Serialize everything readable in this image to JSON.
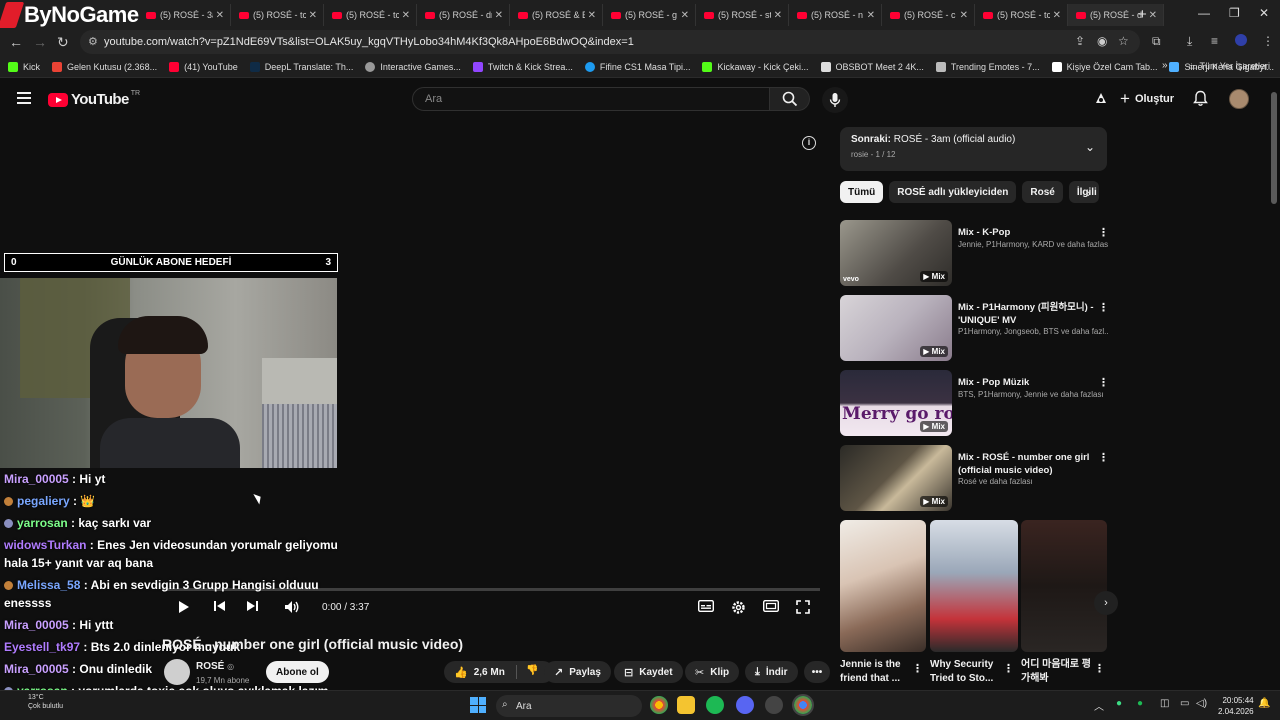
{
  "overlay": {
    "brand": "ByNoGame"
  },
  "browser": {
    "tabs": [
      {
        "title": "(5) ROSÉ - 3a"
      },
      {
        "title": "(5) ROSÉ - tc"
      },
      {
        "title": "(5) ROSÉ - tc"
      },
      {
        "title": "(5) ROSÉ - dr"
      },
      {
        "title": "(5) ROSÉ & B"
      },
      {
        "title": "(5) ROSÉ - g"
      },
      {
        "title": "(5) ROSÉ - st"
      },
      {
        "title": "(5) ROSÉ - n"
      },
      {
        "title": "(5) ROSÉ - c"
      },
      {
        "title": "(5) ROSÉ - tc"
      },
      {
        "title": "(5) ROSÉ - d"
      }
    ],
    "url": "youtube.com/watch?v=pZ1NdE69VTs&list=OLAK5uy_kgqVTHyLobo34hM4Kf3Qk8AHpoE6BdwOQ&index=1",
    "bookmarks": [
      {
        "label": "Kick",
        "color": "#53fc18"
      },
      {
        "label": "Gelen Kutusu (2.368...",
        "color": "#ea4335"
      },
      {
        "label": "(41) YouTube",
        "color": "#ff0033"
      },
      {
        "label": "DeepL Translate: Th...",
        "color": "#0f2b46"
      },
      {
        "label": "Interactive Games...",
        "color": "#999999"
      },
      {
        "label": "Twitch & Kick Strea...",
        "color": "#9146ff"
      },
      {
        "label": "Fifine CS1 Masa Tipi...",
        "color": "#1d9bf0"
      },
      {
        "label": "Kickaway - Kick Çeki...",
        "color": "#53fc18"
      },
      {
        "label": "OBSBOT Meet 2 4K...",
        "color": "#dddddd"
      },
      {
        "label": "Trending Emotes - 7...",
        "color": "#bbbbbb"
      },
      {
        "label": "Kişiye Özel Cam Tab...",
        "color": "#ffffff"
      },
      {
        "label": "Sinerji Keria Gigabyt...",
        "color": "#4fb0ff"
      }
    ],
    "all_bookmarks": "Tüm Yer İşaretleri"
  },
  "yt_header": {
    "logo_text": "YouTube",
    "country": "TR",
    "search_placeholder": "Ara",
    "create_label": "Oluştur"
  },
  "stream_overlay": {
    "goal_left": "0",
    "goal_title": "GÜNLÜK ABONE HEDEFİ",
    "goal_right": "3",
    "chat": [
      {
        "user": "Mira_00005",
        "text": " : Hi yt",
        "color": "#c9a0ff",
        "badge": ""
      },
      {
        "user": "pegaliery",
        "text": " : 👑",
        "color": "#7aa7ff",
        "badge": "#c2803a"
      },
      {
        "user": "yarrosan",
        "text": " : kaç sarkı var",
        "color": "#7dff8a",
        "badge": "#8a8fbf"
      },
      {
        "user": "widowsTurkan",
        "text": " : Enes Jen videosundan yorumalr geliyomu hala 15+ yanıt var aq bana",
        "color": "#b07cff",
        "badge": ""
      },
      {
        "user": "Melissa_58",
        "text": " : Abi en sevdigin 3 Grupp Hangisi olduuu enessss",
        "color": "#7aa7ff",
        "badge": "#c2803a"
      },
      {
        "user": "Mira_00005",
        "text": " : Hi yttt",
        "color": "#c9a0ff",
        "badge": ""
      },
      {
        "user": "Eyestell_tk97",
        "text": " : Bts 2.0 dinleniyor muyduk",
        "color": "#b07cff",
        "badge": ""
      },
      {
        "user": "Mira_00005",
        "text": " : Onu dinledik",
        "color": "#c9a0ff",
        "badge": ""
      },
      {
        "user": "yarrosan",
        "text": " : yorumlarda toxic çok oluyo ayıklamak lazım",
        "color": "#7dff8a",
        "badge": "#8a8fbf"
      },
      {
        "user": "arda",
        "text": "",
        "color": "#ffffff",
        "badge": ""
      }
    ]
  },
  "player": {
    "time": "0:00 / 3:37",
    "progress": 0,
    "title": "ROSÉ - number one girl (official music video)"
  },
  "channel": {
    "name": "ROSÉ",
    "verified_mark": "◎",
    "subs": "19,7 Mn abone",
    "subscribe": "Abone ol",
    "likes": "2,6 Mn",
    "share": "Paylaş",
    "save": "Kaydet",
    "clip": "Klip",
    "download": "İndir"
  },
  "sidebar": {
    "next_prefix": "Sonraki:",
    "next_title": " ROSÉ - 3am (official audio)",
    "next_sub": "rosie - 1 / 12",
    "chips": [
      "Tümü",
      "ROSÉ adlı yükleyiciden",
      "Rosé",
      "İlgili"
    ],
    "recs": [
      {
        "title": "Mix - K-Pop",
        "sub": "Jennie, P1Harmony, KARD ve daha fazlası",
        "badge": "Mix"
      },
      {
        "title": "Mix - P1Harmony (피원하모니) - 'UNIQUE' MV",
        "sub": "P1Harmony, Jongseob, BTS ve daha fazl...",
        "badge": "Mix"
      },
      {
        "title": "Mix - Pop Müzik",
        "sub": "BTS, P1Harmony, Jennie ve daha fazlası",
        "badge": "Mix"
      },
      {
        "title": "Mix - ROSÉ - number one girl (official music video)",
        "sub": "Rosé ve daha fazlası",
        "badge": "Mix"
      }
    ],
    "thumb3_text": "Merry go round",
    "vevo": "vevo",
    "shorts": [
      {
        "title": "Jennie is the friend that ..."
      },
      {
        "title": "Why Security Tried to Sto..."
      },
      {
        "title": "어디 마음대로 평가해봐"
      }
    ]
  },
  "taskbar": {
    "temp": "13°C",
    "weather": "Çok bulutlu",
    "search": "Ara",
    "time": "20:05:44",
    "date": "2.04.2026"
  }
}
